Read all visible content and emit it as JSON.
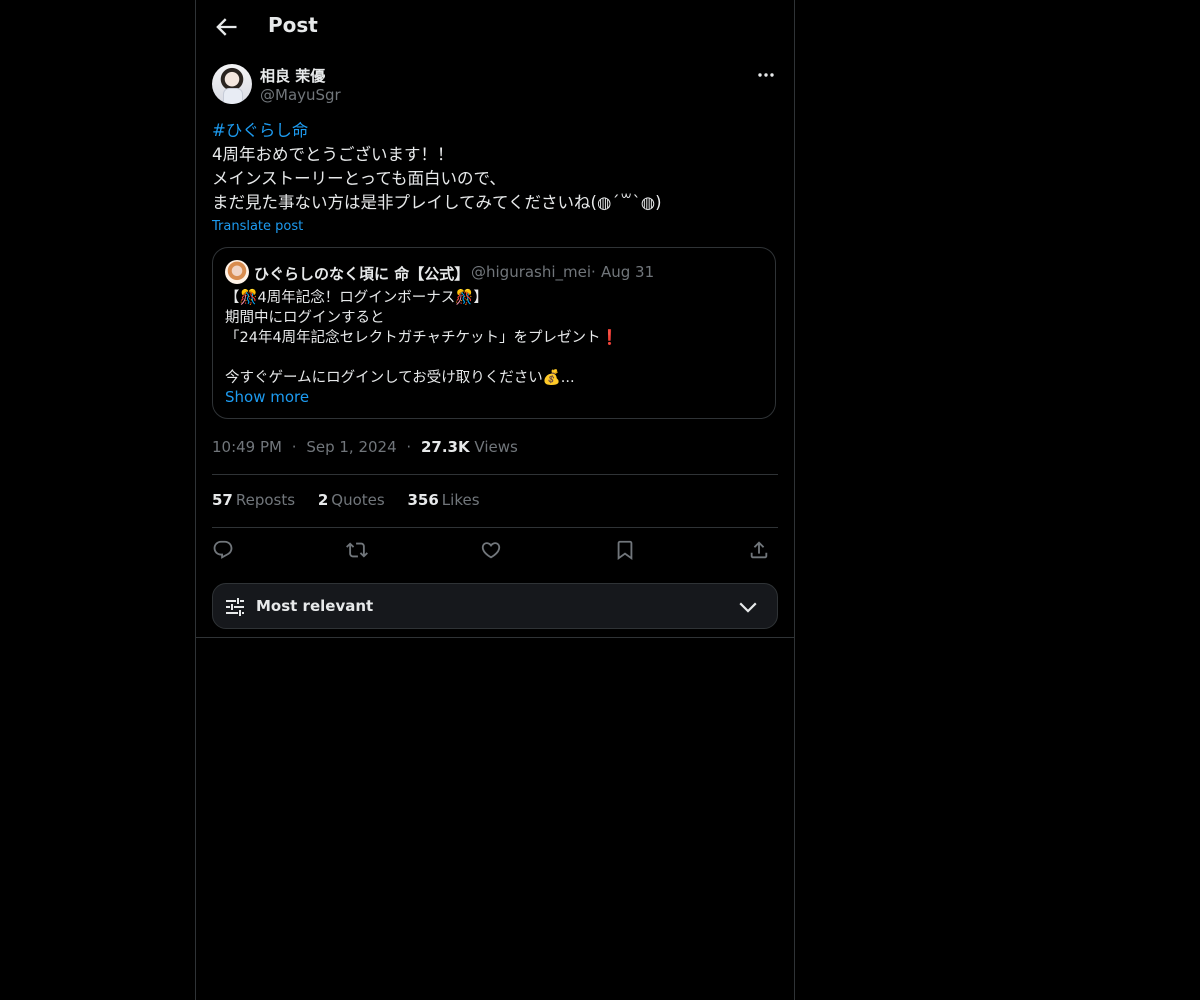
{
  "header": {
    "title": "Post",
    "back_icon": "arrow-left-icon"
  },
  "author": {
    "name": "相良 茉優",
    "handle": "@MayuSgr",
    "more_icon": "more-horizontal-icon"
  },
  "post": {
    "hashtag": "#ひぐらし命",
    "lines": [
      "4周年おめでとうございます！！",
      "メインストーリーとっても面白いので、",
      "まだ見た事ない方は是非プレイしてみてくださいね(◍´꒳`◍)"
    ],
    "translate_label": "Translate post"
  },
  "quote": {
    "name": "ひぐらしのなく頃に 命【公式】",
    "handle": "@higurashi_mei",
    "separator": "·",
    "date": "Aug 31",
    "lines": [
      "【🎊4周年記念！ログインボーナス🎊】",
      " 期間中にログインすると",
      "「24年4周年記念セレクトガチャチケット」をプレゼント❗",
      "",
      "今すぐゲームにログインしてお受け取りください💰..."
    ],
    "show_more": "Show more"
  },
  "meta": {
    "time": "10:49 PM",
    "sep1": "·",
    "date": "Sep 1, 2024",
    "sep2": "·",
    "views_count": "27.3K",
    "views_label": "Views"
  },
  "stats": {
    "reposts_count": "57",
    "reposts_label": "Reposts",
    "quotes_count": "2",
    "quotes_label": "Quotes",
    "likes_count": "356",
    "likes_label": "Likes"
  },
  "actions": [
    "reply-icon",
    "repost-icon",
    "like-icon",
    "bookmark-icon",
    "share-icon"
  ],
  "sort": {
    "label": "Most relevant",
    "icon": "sliders-icon",
    "chevron": "chevron-down-icon"
  },
  "colors": {
    "background": "#000000",
    "text": "#e7e9ea",
    "muted": "#71767b",
    "accent": "#1d9bf0",
    "border": "#2f3336"
  }
}
